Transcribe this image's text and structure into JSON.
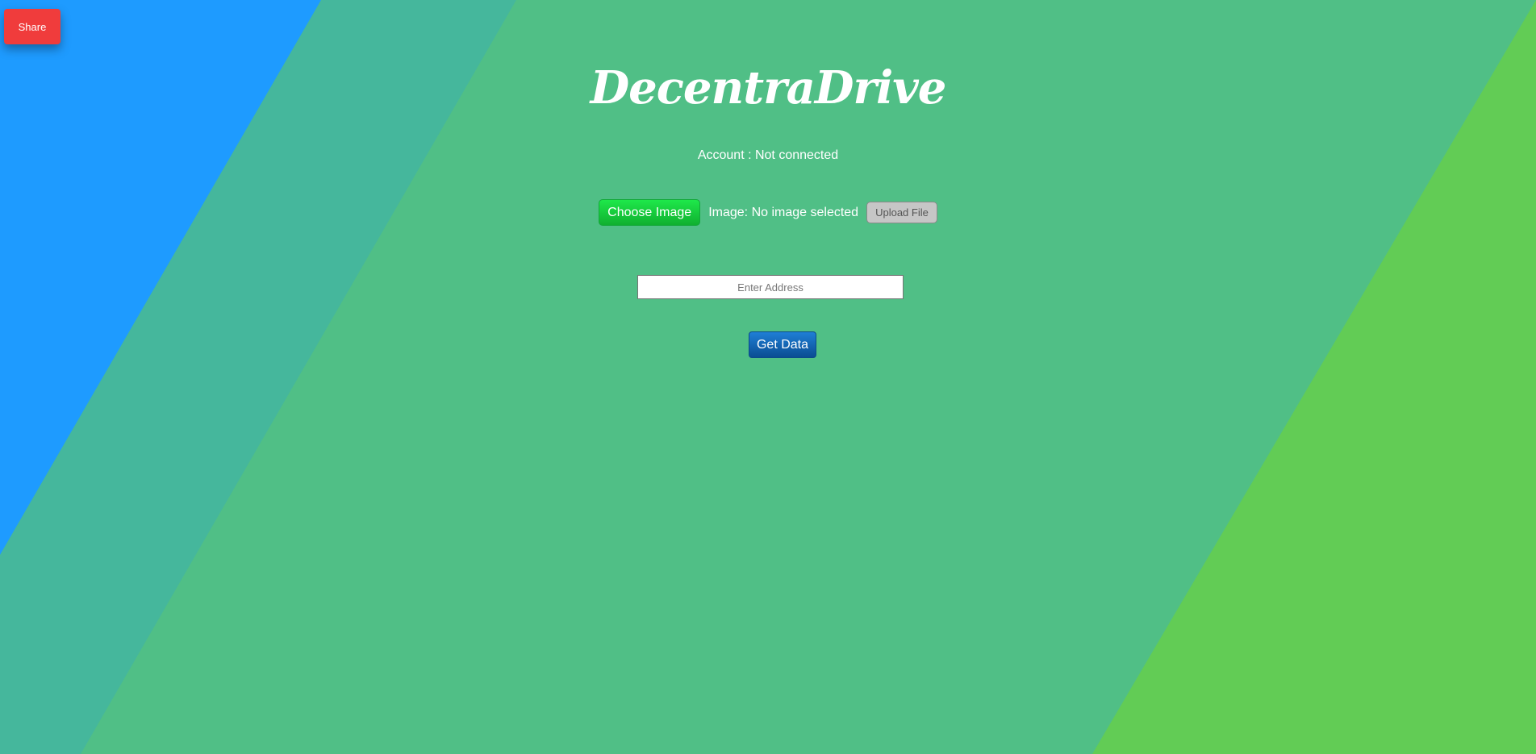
{
  "app": {
    "title": "DecentraDrive"
  },
  "share": {
    "label": "Share"
  },
  "account": {
    "text": "Account : Not connected"
  },
  "upload": {
    "choose_label": "Choose Image",
    "image_status": "Image: No image selected",
    "upload_label": "Upload File"
  },
  "address": {
    "placeholder": "Enter Address",
    "value": ""
  },
  "get_data": {
    "label": "Get Data"
  },
  "colors": {
    "left_band": "#1e9bff",
    "middle_band": "#45b79c",
    "main": "#50bf86",
    "right_band": "#62cc55",
    "share": "#f03c3c",
    "choose": "#18d43c",
    "get_data": "#0a5fb0"
  }
}
